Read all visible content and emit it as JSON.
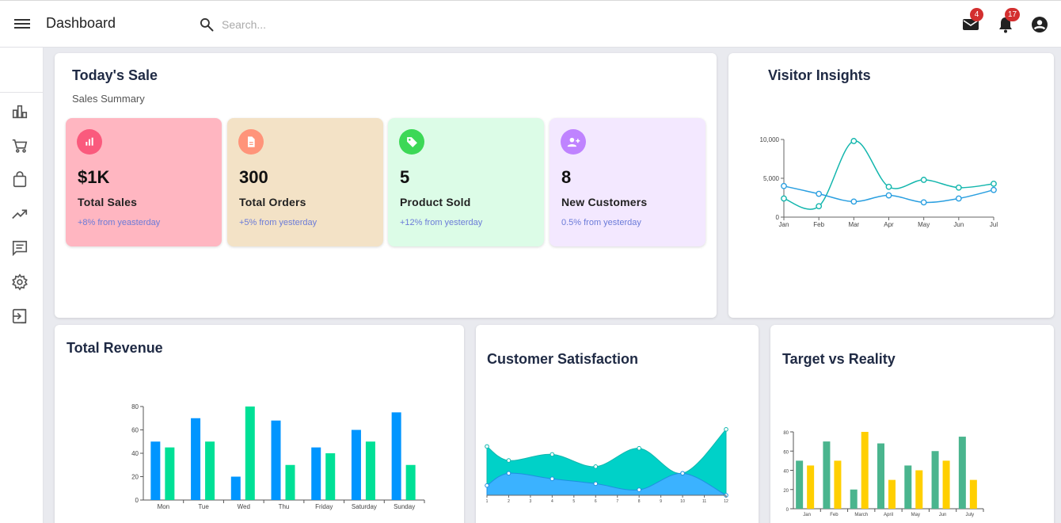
{
  "header": {
    "title": "Dashboard",
    "search_placeholder": "Search...",
    "mail_count": "4",
    "notification_count": "17"
  },
  "sidebar": {
    "items": [
      {
        "icon": "bar-chart-icon"
      },
      {
        "icon": "cart-icon"
      },
      {
        "icon": "shopping-bag-icon"
      },
      {
        "icon": "trending-up-icon"
      },
      {
        "icon": "message-icon"
      },
      {
        "icon": "settings-icon"
      },
      {
        "icon": "logout-icon"
      }
    ]
  },
  "todays_sale": {
    "title": "Today's Sale",
    "subtitle": "Sales Summary",
    "stats": [
      {
        "value": "$1K",
        "label": "Total Sales",
        "change": "+8% from yeasterday",
        "bg": "#ffb6c1",
        "icon_bg": "#fa5a7d",
        "icon": "bar-chart-icon"
      },
      {
        "value": "300",
        "label": "Total Orders",
        "change": "+5% from yesterday",
        "bg": "#f3e2c6",
        "icon_bg": "#ff947a",
        "icon": "document-icon"
      },
      {
        "value": "5",
        "label": "Product Sold",
        "change": "+12% from yesterday",
        "bg": "#dcfce7",
        "icon_bg": "#3cd856",
        "icon": "tag-icon"
      },
      {
        "value": "8",
        "label": "New Customers",
        "change": "0.5% from yesterday",
        "bg": "#f3e8ff",
        "icon_bg": "#bf83ff",
        "icon": "add-user-icon"
      }
    ]
  },
  "visitor_insights": {
    "title": "Visitor Insights"
  },
  "total_revenue": {
    "title": "Total Revenue"
  },
  "customer_satisfaction": {
    "title": "Customer Satisfaction"
  },
  "target_vs_reality": {
    "title": "Target vs Reality"
  },
  "chart_data": [
    {
      "type": "line",
      "title": "Visitor Insights",
      "categories": [
        "Jan",
        "Feb",
        "Mar",
        "Apr",
        "May",
        "Jun",
        "Jul"
      ],
      "ylim": [
        0,
        10000
      ],
      "yticks": [
        "0",
        "5,000",
        "10,000"
      ],
      "series": [
        {
          "values": [
            2400,
            1400,
            9800,
            3900,
            4800,
            3800,
            4300
          ],
          "color": "#13b6ad"
        },
        {
          "values": [
            4000,
            3000,
            2000,
            2800,
            1900,
            2400,
            3500
          ],
          "color": "#2a9fe0"
        }
      ]
    },
    {
      "type": "bar",
      "title": "Total Revenue",
      "categories": [
        "Mon",
        "Tue",
        "Wed",
        "Thu",
        "Friday",
        "Saturday",
        "Sunday"
      ],
      "ylim": [
        0,
        80
      ],
      "yticks": [
        "0",
        "20",
        "40",
        "60",
        "80"
      ],
      "series": [
        {
          "values": [
            50,
            70,
            20,
            68,
            45,
            60,
            75
          ],
          "color": "#0095ff"
        },
        {
          "values": [
            45,
            50,
            80,
            30,
            40,
            50,
            30
          ],
          "color": "#00e096"
        }
      ]
    },
    {
      "type": "area",
      "title": "Customer Satisfaction",
      "x": [
        1,
        2,
        3,
        4,
        5,
        6,
        7,
        8,
        9,
        10,
        11,
        12
      ],
      "ylim": [
        0,
        100
      ],
      "series": [
        {
          "x": [
            1,
            2,
            4,
            6,
            8,
            10,
            12
          ],
          "values": [
            80,
            57,
            67,
            47,
            77,
            36,
            108
          ],
          "color": "#00d1c8"
        },
        {
          "x": [
            1,
            2,
            4,
            6,
            8,
            10,
            12
          ],
          "values": [
            16,
            36,
            27,
            19,
            9,
            36,
            0
          ],
          "color": "#3bb2ff"
        }
      ]
    },
    {
      "type": "bar",
      "title": "Target vs Reality",
      "categories": [
        "Jan",
        "Feb",
        "March",
        "April",
        "May",
        "Jun",
        "July"
      ],
      "ylim": [
        0,
        80
      ],
      "yticks": [
        "0",
        "20",
        "40",
        "60",
        "80"
      ],
      "series": [
        {
          "values": [
            50,
            70,
            20,
            68,
            45,
            60,
            75
          ],
          "color": "#4ab58e"
        },
        {
          "values": [
            45,
            50,
            80,
            30,
            40,
            50,
            30
          ],
          "color": "#ffcf00"
        }
      ]
    }
  ]
}
